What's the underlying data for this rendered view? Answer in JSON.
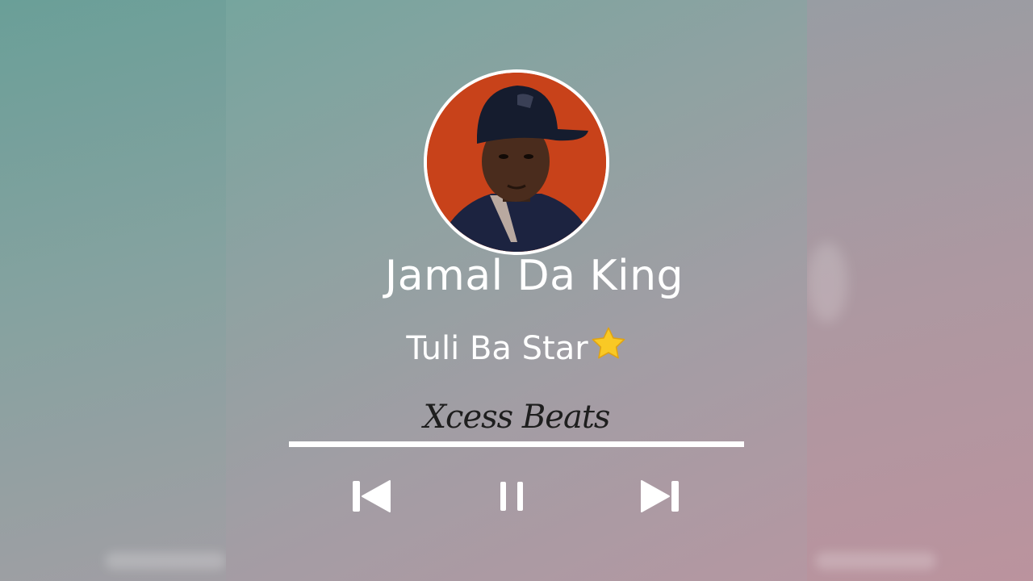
{
  "player": {
    "artist": "Jamal Da King",
    "title": "Tuli Ba Star",
    "producer": "Xcess Beats",
    "progress": 1.0,
    "state": "playing"
  },
  "controls": {
    "previous_icon": "skip-previous-icon",
    "pause_icon": "pause-icon",
    "next_icon": "skip-next-icon"
  },
  "colors": {
    "text": "#ffffff",
    "producer_text": "#1e1e1e",
    "avatar_background": "#c8421a"
  }
}
